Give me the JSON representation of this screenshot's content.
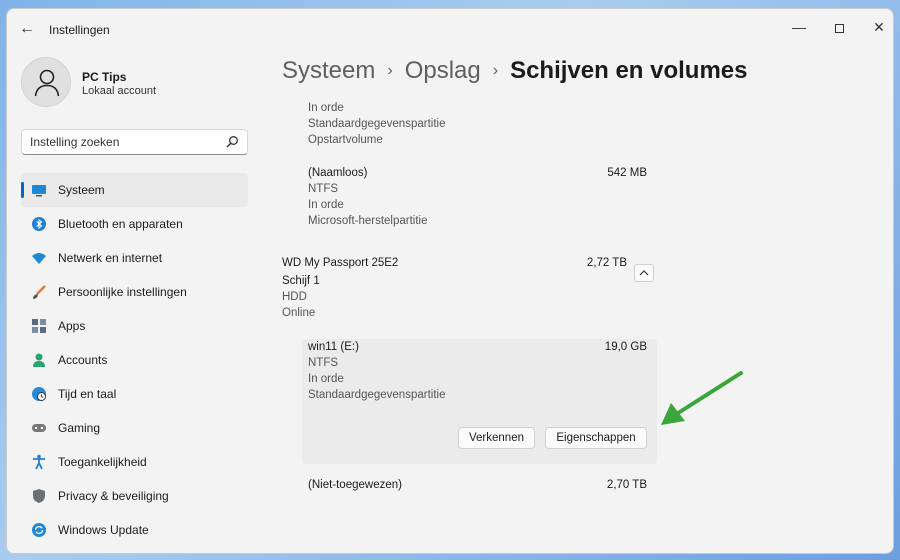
{
  "window": {
    "title": "Instellingen",
    "back_glyph": "←",
    "minimize_glyph": "—",
    "close_glyph": "✕"
  },
  "profile": {
    "name": "PC Tips",
    "account_type": "Lokaal account"
  },
  "search": {
    "placeholder": "Instelling zoeken"
  },
  "sidebar": {
    "items": [
      {
        "label": "Systeem",
        "icon": "monitor-icon",
        "active": true
      },
      {
        "label": "Bluetooth en apparaten",
        "icon": "bluetooth-icon"
      },
      {
        "label": "Netwerk en internet",
        "icon": "wifi-icon"
      },
      {
        "label": "Persoonlijke instellingen",
        "icon": "brush-icon"
      },
      {
        "label": "Apps",
        "icon": "apps-icon"
      },
      {
        "label": "Accounts",
        "icon": "person-icon"
      },
      {
        "label": "Tijd en taal",
        "icon": "globe-clock-icon"
      },
      {
        "label": "Gaming",
        "icon": "gamepad-icon"
      },
      {
        "label": "Toegankelijkheid",
        "icon": "accessibility-icon"
      },
      {
        "label": "Privacy & beveiliging",
        "icon": "shield-icon"
      },
      {
        "label": "Windows Update",
        "icon": "update-icon"
      }
    ]
  },
  "breadcrumb": {
    "items": [
      "Systeem",
      "Opslag",
      "Schijven en volumes"
    ],
    "separator": "›"
  },
  "partitions": {
    "top_partial": {
      "status": "In orde",
      "type": "Standaardgegevenspartitie",
      "extra": "Opstartvolume"
    },
    "recovery": {
      "name": "(Naamloos)",
      "size": "542 MB",
      "fs": "NTFS",
      "status": "In orde",
      "type": "Microsoft-herstelpartitie"
    }
  },
  "disk": {
    "name": "WD My Passport 25E2",
    "size": "2,72 TB",
    "number": "Schijf 1",
    "media": "HDD",
    "state": "Online"
  },
  "volume": {
    "name": "win11 (E:)",
    "size": "19,0 GB",
    "fs": "NTFS",
    "status": "In orde",
    "type": "Standaardgegevenspartitie",
    "explore_label": "Verkennen",
    "properties_label": "Eigenschappen"
  },
  "unallocated": {
    "name": "(Niet-toegewezen)",
    "size": "2,70 TB"
  },
  "colors": {
    "accent": "#0067c0",
    "arrow": "#3aa53a"
  }
}
